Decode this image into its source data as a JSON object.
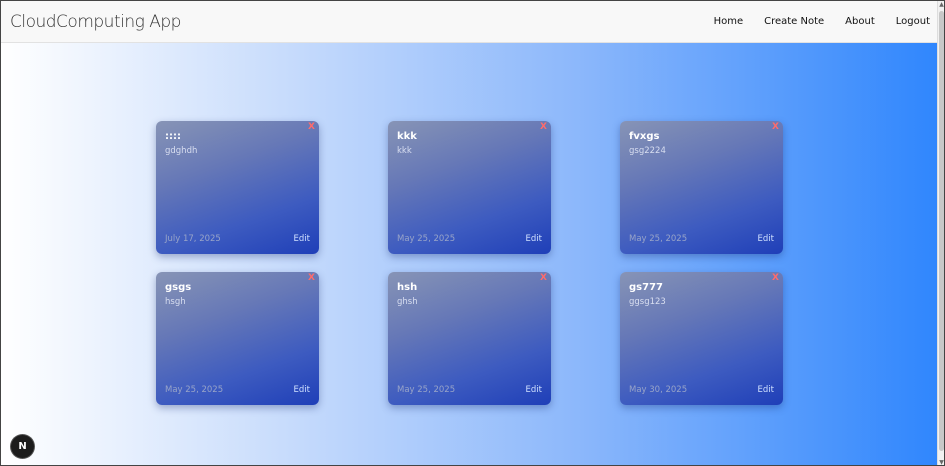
{
  "navbar": {
    "brand": "CloudComputing App",
    "links": [
      {
        "label": "Home"
      },
      {
        "label": "Create Note"
      },
      {
        "label": "About"
      },
      {
        "label": "Logout"
      }
    ]
  },
  "notes": [
    {
      "title": "::::",
      "body": "gdghdh",
      "date": "July 17, 2025",
      "edit_label": "Edit",
      "delete_label": "X"
    },
    {
      "title": "kkk",
      "body": "kkk",
      "date": "May 25, 2025",
      "edit_label": "Edit",
      "delete_label": "X"
    },
    {
      "title": "fvxgs",
      "body": "gsg2224",
      "date": "May 25, 2025",
      "edit_label": "Edit",
      "delete_label": "X"
    },
    {
      "title": "gsgs",
      "body": "hsgh",
      "date": "May 25, 2025",
      "edit_label": "Edit",
      "delete_label": "X"
    },
    {
      "title": "hsh",
      "body": "ghsh",
      "date": "May 25, 2025",
      "edit_label": "Edit",
      "delete_label": "X"
    },
    {
      "title": "gs777",
      "body": "ggsg123",
      "date": "May 30, 2025",
      "edit_label": "Edit",
      "delete_label": "X"
    }
  ],
  "dev_badge": {
    "label": "N"
  },
  "colors": {
    "gradient_start": "#ffffff",
    "gradient_end": "#2f86fd",
    "delete": "#ff6b6b",
    "card_dark": "#1f3fb8"
  }
}
